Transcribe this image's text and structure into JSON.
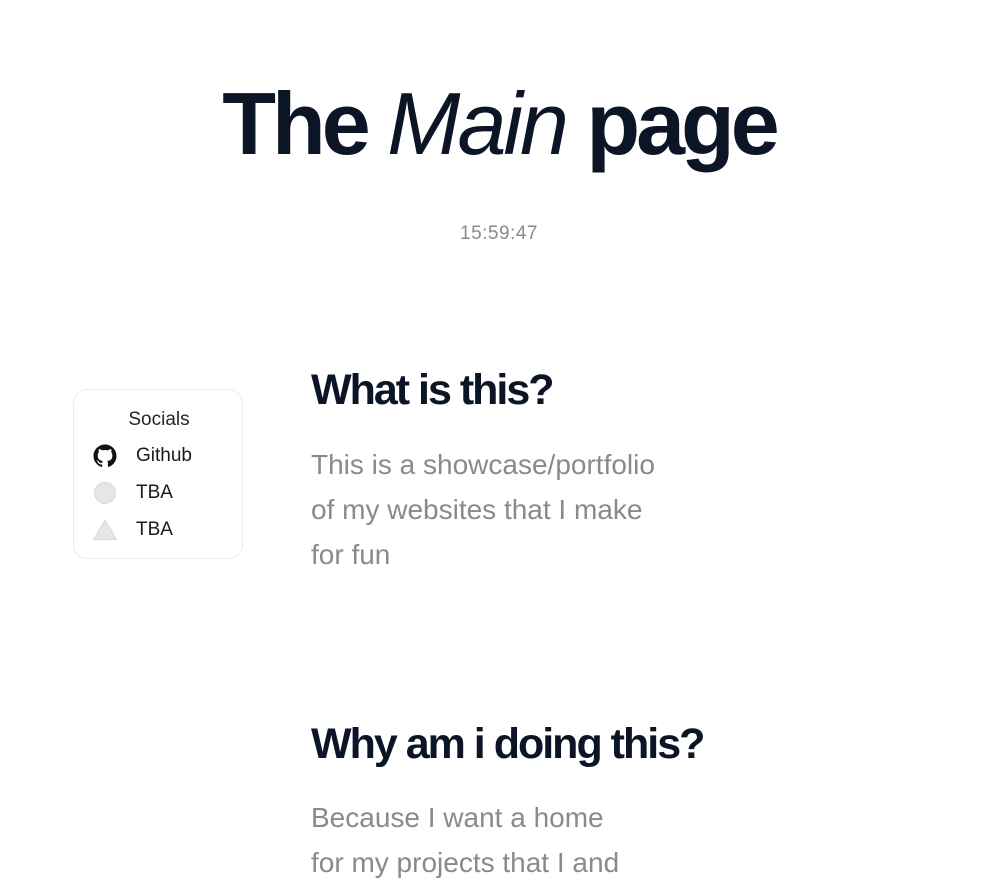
{
  "header": {
    "title_part1": "The",
    "title_part2": "Main",
    "title_part3": "page",
    "clock": "15:59:47"
  },
  "socials": {
    "title": "Socials",
    "items": [
      {
        "label": "Github",
        "icon": "github-icon"
      },
      {
        "label": "TBA",
        "icon": "circle-placeholder-icon"
      },
      {
        "label": "TBA",
        "icon": "triangle-placeholder-icon"
      }
    ]
  },
  "sections": [
    {
      "heading": "What is this?",
      "lines": [
        "This is a showcase/portfolio",
        "of my websites that I make",
        "for fun"
      ]
    },
    {
      "heading": "Why am i doing this?",
      "lines": [
        "Because I want a home",
        "for my projects that I and"
      ]
    }
  ],
  "colors": {
    "heading": "#0b1526",
    "muted_text": "#8a8a8a",
    "card_border": "#ececec",
    "placeholder_icon": "#e5e5e5"
  }
}
